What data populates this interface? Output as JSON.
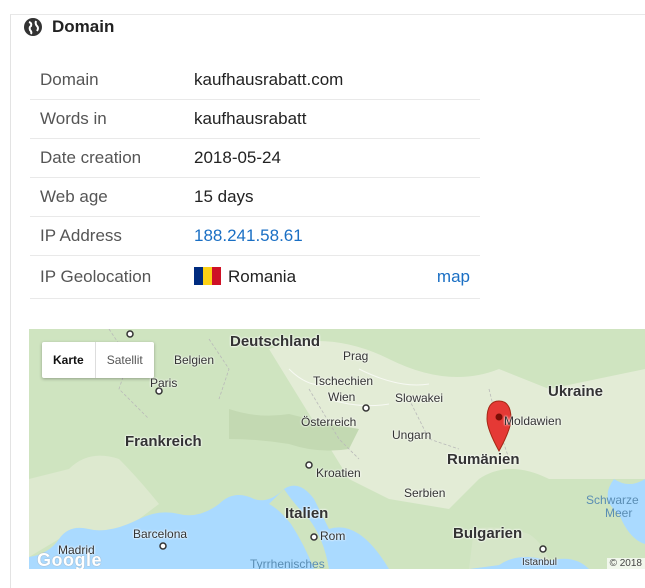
{
  "section": {
    "title": "Domain",
    "icon": "globe-icon"
  },
  "rows": [
    {
      "key": "Domain",
      "value": "kaufhausrabatt.com"
    },
    {
      "key": "Words in",
      "value": "kaufhausrabatt"
    },
    {
      "key": "Date creation",
      "value": "2018-05-24"
    },
    {
      "key": "Web age",
      "value": "15 days"
    },
    {
      "key": "IP Address",
      "value": "188.241.58.61"
    },
    {
      "key": "IP Geolocation",
      "value": "Romania",
      "link": "map"
    }
  ],
  "flag_colors": [
    "#002b7f",
    "#fcd116",
    "#ce1126"
  ],
  "map": {
    "type_buttons": [
      "Karte",
      "Satellit"
    ],
    "labels": {
      "deutschland": "Deutschland",
      "belgien": "Belgien",
      "prag": "Prag",
      "paris": "Paris",
      "tschechien": "Tschechien",
      "wien": "Wien",
      "slowakei": "Slowakei",
      "ukraine": "Ukraine",
      "frankreich": "Frankreich",
      "osterreich": "Österreich",
      "ungarn": "Ungarn",
      "moldawien": "Moldawien",
      "rumanien": "Rumänien",
      "kroatien": "Kroatien",
      "schwarze": "Schwarze",
      "meer": "Meer",
      "serbien": "Serbien",
      "italien": "Italien",
      "barcelona": "Barcelona",
      "rom": "Rom",
      "bulgarien": "Bulgarien",
      "madrid": "Madrid",
      "tyrrhenisches": "Tyrrhenisches",
      "istanbul": "Istanbul"
    },
    "google": "Google",
    "attribution": "© 2018"
  }
}
